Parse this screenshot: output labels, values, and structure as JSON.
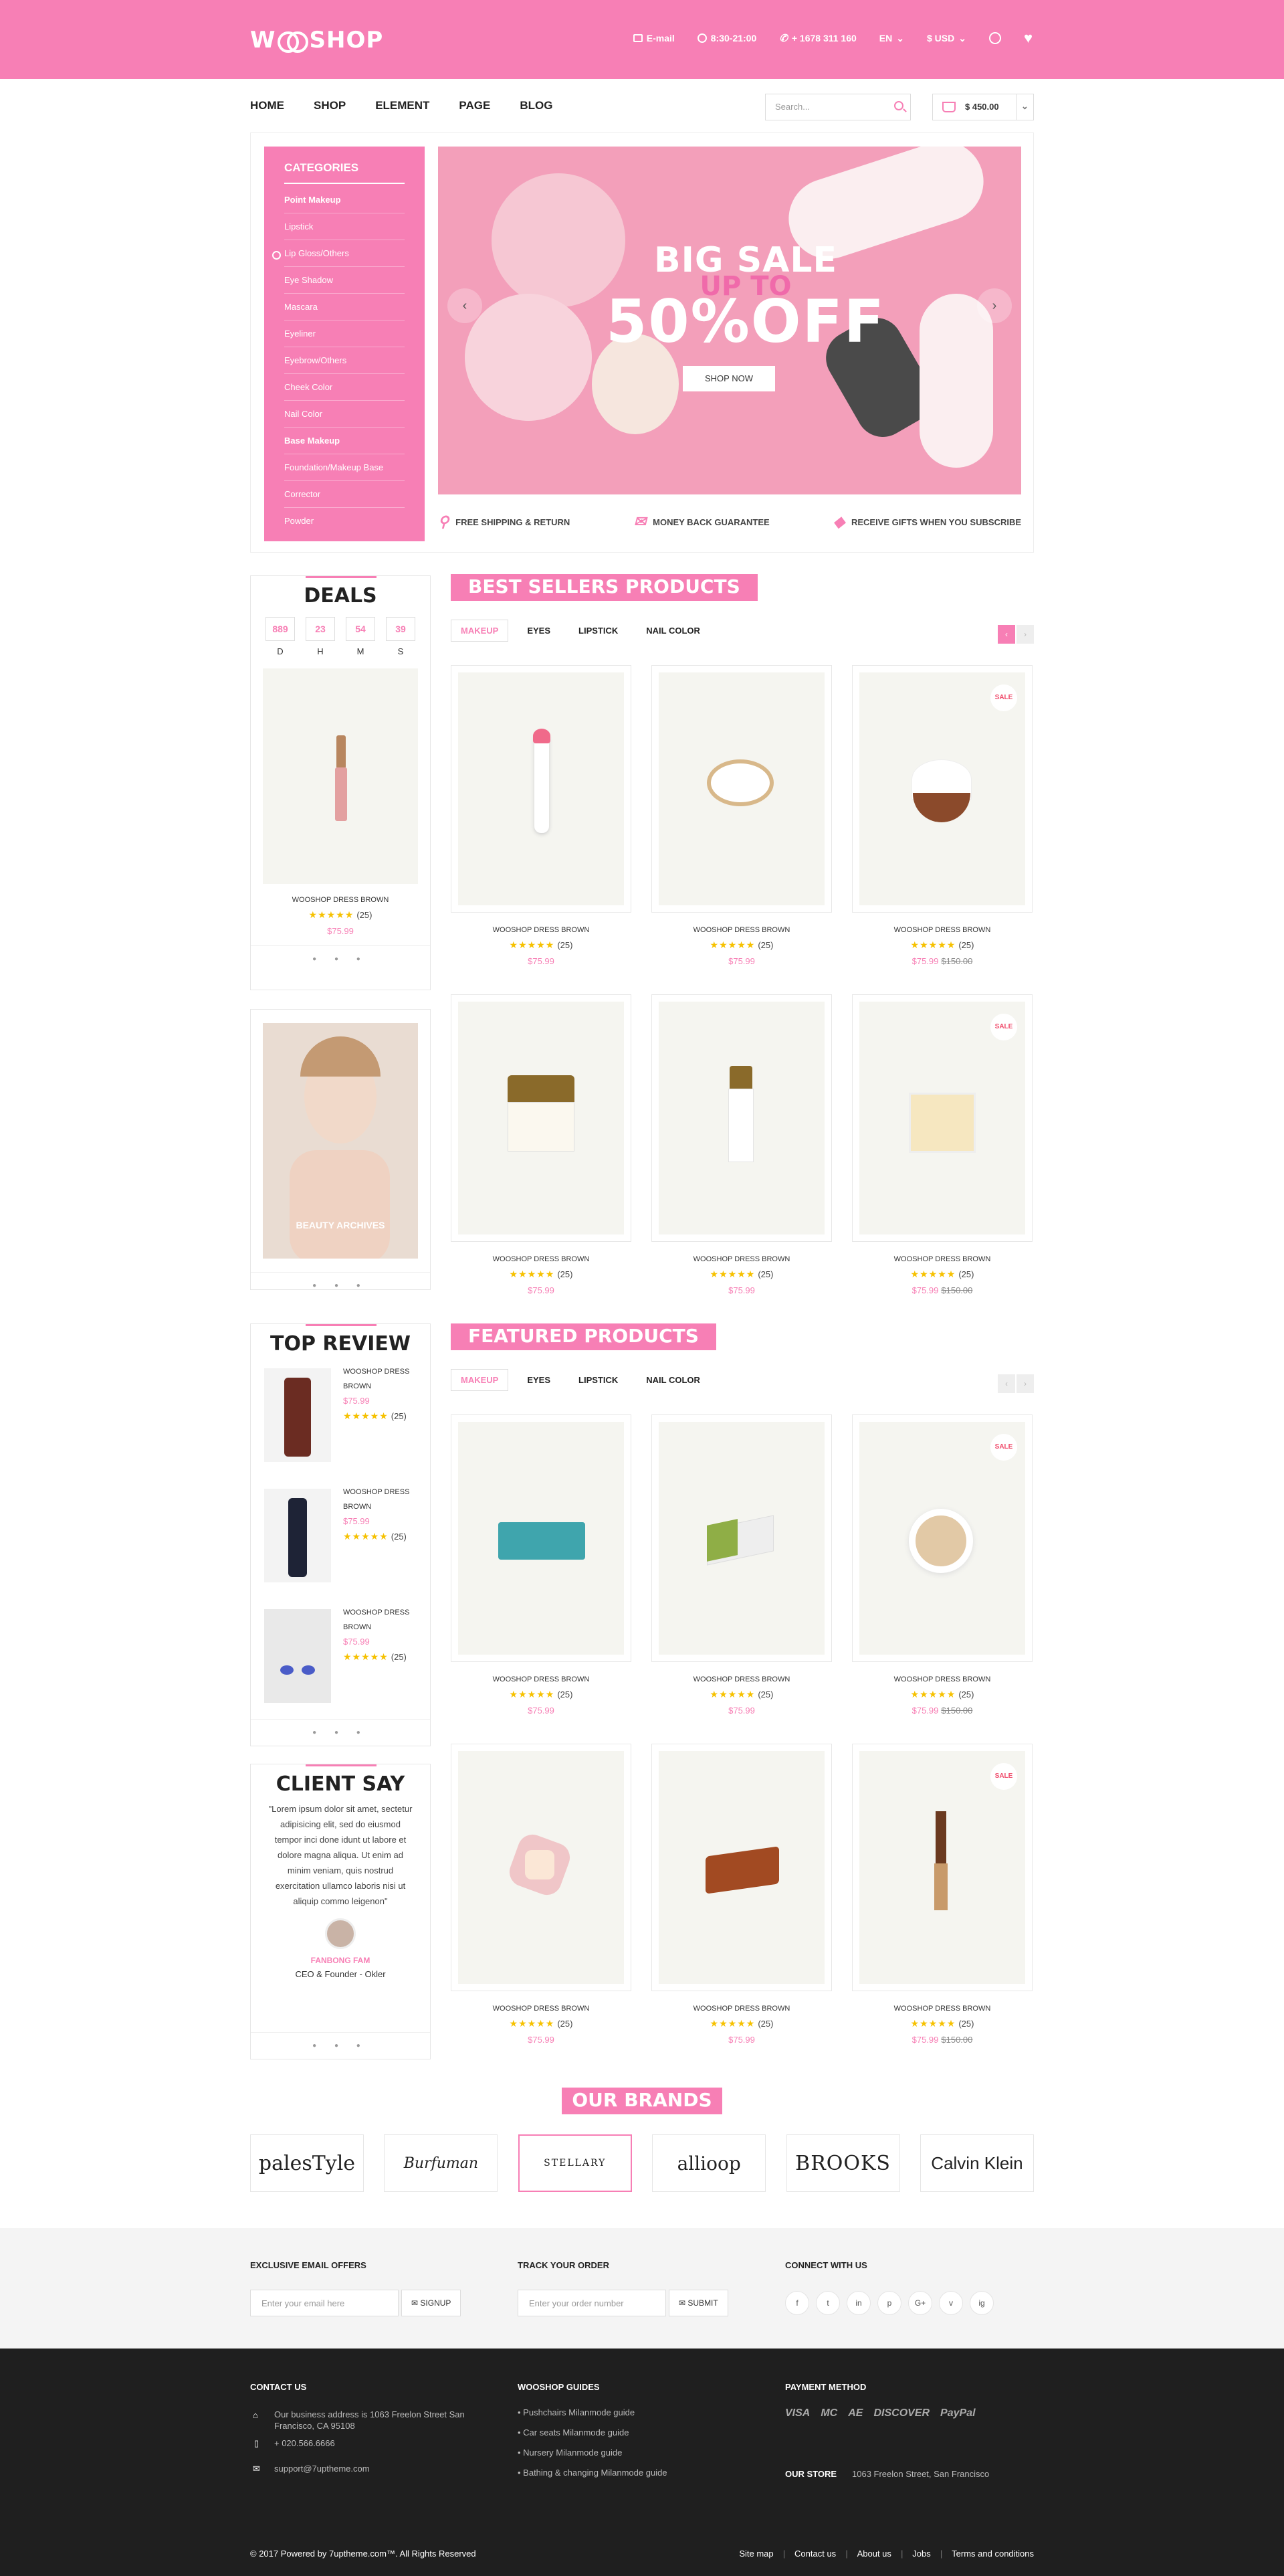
{
  "brand": {
    "logo_left": "W",
    "logo_right": "SHOP"
  },
  "topbar": {
    "email": "E-mail",
    "hours": "8:30-21:00",
    "phone": "+ 1678 311 160",
    "lang": "EN",
    "currency": "$ USD"
  },
  "nav": {
    "items": [
      "HOME",
      "SHOP",
      "ELEMENT",
      "PAGE",
      "BLOG"
    ],
    "search_placeholder": "Search...",
    "cart_total": "$ 450.00"
  },
  "categories": {
    "title": "CATEGORIES",
    "items": [
      "Point Makeup",
      "Lipstick",
      "Lip Gloss/Others",
      "Eye Shadow",
      "Mascara",
      "Eyeliner",
      "Eyebrow/Others",
      "Cheek Color",
      "Nail Color",
      "Base Makeup",
      "Foundation/Makeup Base",
      "Corrector",
      "Powder"
    ]
  },
  "hero": {
    "line1": "BIG SALE",
    "line2": "UP TO",
    "line3": "50%OFF",
    "button": "SHOP NOW",
    "prev": "‹",
    "next": "›"
  },
  "features": [
    "FREE SHIPPING & RETURN",
    "MONEY BACK GUARANTEE",
    "RECEIVE GIFTS WHEN YOU SUBSCRIBE"
  ],
  "deals": {
    "title": "DEALS",
    "countdown": [
      {
        "n": "889",
        "l": "D"
      },
      {
        "n": "23",
        "l": "H"
      },
      {
        "n": "54",
        "l": "M"
      },
      {
        "n": "39",
        "l": "S"
      }
    ],
    "name": "WOOSHOP DRESS BROWN",
    "reviews": "(25)",
    "price": "$75.99"
  },
  "banner": {
    "caption": "BEAUTY ARCHIVES"
  },
  "top_review": {
    "title": "TOP REVIEW",
    "items": [
      {
        "name": "WOOSHOP DRESS BROWN",
        "price": "$75.99",
        "reviews": "(25)"
      },
      {
        "name": "WOOSHOP DRESS BROWN",
        "price": "$75.99",
        "reviews": "(25)"
      },
      {
        "name": "WOOSHOP DRESS BROWN",
        "price": "$75.99",
        "reviews": "(25)"
      }
    ]
  },
  "client": {
    "title": "CLIENT SAY",
    "quote": "\"Lorem ipsum dolor sit amet, sectetur adipisicing elit, sed do eiusmod tempor inci done idunt ut labore et dolore magna aliqua. Ut enim ad minim veniam, quis nostrud exercitation ullamco laboris nisi ut aliquip commo leigenon\"",
    "name": "FANBONG FAM",
    "role": "CEO & Founder - Okler"
  },
  "best_sellers": {
    "title": "BEST SELLERS PRODUCTS",
    "tabs": [
      "MAKEUP",
      "EYES",
      "LIPSTICK",
      "NAIL COLOR"
    ],
    "products": [
      {
        "name": "WOOSHOP DRESS BROWN",
        "reviews": "(25)",
        "price": "$75.99",
        "old": "",
        "sale": ""
      },
      {
        "name": "WOOSHOP DRESS BROWN",
        "reviews": "(25)",
        "price": "$75.99",
        "old": "",
        "sale": ""
      },
      {
        "name": "WOOSHOP DRESS BROWN",
        "reviews": "(25)",
        "price": "$75.99",
        "old": "$150.00",
        "sale": "SALE"
      },
      {
        "name": "WOOSHOP DRESS BROWN",
        "reviews": "(25)",
        "price": "$75.99",
        "old": "",
        "sale": ""
      },
      {
        "name": "WOOSHOP DRESS BROWN",
        "reviews": "(25)",
        "price": "$75.99",
        "old": "",
        "sale": ""
      },
      {
        "name": "WOOSHOP DRESS BROWN",
        "reviews": "(25)",
        "price": "$75.99",
        "old": "$150.00",
        "sale": "SALE"
      }
    ]
  },
  "featured": {
    "title": "FEATURED PRODUCTS",
    "tabs": [
      "MAKEUP",
      "EYES",
      "LIPSTICK",
      "NAIL COLOR"
    ],
    "products": [
      {
        "name": "WOOSHOP DRESS BROWN",
        "reviews": "(25)",
        "price": "$75.99",
        "old": "",
        "sale": ""
      },
      {
        "name": "WOOSHOP DRESS BROWN",
        "reviews": "(25)",
        "price": "$75.99",
        "old": "",
        "sale": ""
      },
      {
        "name": "WOOSHOP DRESS BROWN",
        "reviews": "(25)",
        "price": "$75.99",
        "old": "$150.00",
        "sale": "SALE"
      },
      {
        "name": "WOOSHOP DRESS BROWN",
        "reviews": "(25)",
        "price": "$75.99",
        "old": "",
        "sale": ""
      },
      {
        "name": "WOOSHOP DRESS BROWN",
        "reviews": "(25)",
        "price": "$75.99",
        "old": "",
        "sale": ""
      },
      {
        "name": "WOOSHOP DRESS BROWN",
        "reviews": "(25)",
        "price": "$75.99",
        "old": "$150.00",
        "sale": "SALE"
      }
    ]
  },
  "brands": {
    "title": "OUR BRANDS",
    "items": [
      "palesTyle",
      "Burfuman",
      "STELLARY",
      "allioop",
      "BROOKS",
      "Calvin Klein"
    ]
  },
  "newsletter": {
    "email_title": "EXCLUSIVE EMAIL OFFERS",
    "email_placeholder": "Enter your email here",
    "signup": "SIGNUP",
    "track_title": "TRACK YOUR ORDER",
    "track_placeholder": "Enter your order number",
    "submit": "SUBMIT",
    "connect_title": "CONNECT WITH US",
    "social": [
      "f",
      "t",
      "in",
      "p",
      "G+",
      "v",
      "ig"
    ]
  },
  "footer": {
    "contact_title": "CONTACT US",
    "address": "Our business address is 1063 Freelon Street San Francisco, CA 95108",
    "phone": "+ 020.566.6666",
    "email": "support@7uptheme.com",
    "guides_title": "WOOSHOP GUIDES",
    "guides": [
      "Pushchairs Milanmode guide",
      "Car seats Milanmode guide",
      "Nursery Milanmode guide",
      "Bathing & changing Milanmode guide"
    ],
    "payment_title": "PAYMENT METHOD",
    "payments": [
      "VISA",
      "MC",
      "AE",
      "DISCOVER",
      "PayPal"
    ],
    "store_title": "OUR STORE",
    "store_address": "1063 Freelon Street, San Francisco",
    "copyright": "© 2017 Powered by 7uptheme.com™. All Rights Reserved",
    "links": [
      "Site map",
      "Contact us",
      "About us",
      "Jobs",
      "Terms and conditions"
    ]
  },
  "colors": {
    "accent": "#f77fb5",
    "star": "#f6c100",
    "footer": "#1f1f1f"
  }
}
